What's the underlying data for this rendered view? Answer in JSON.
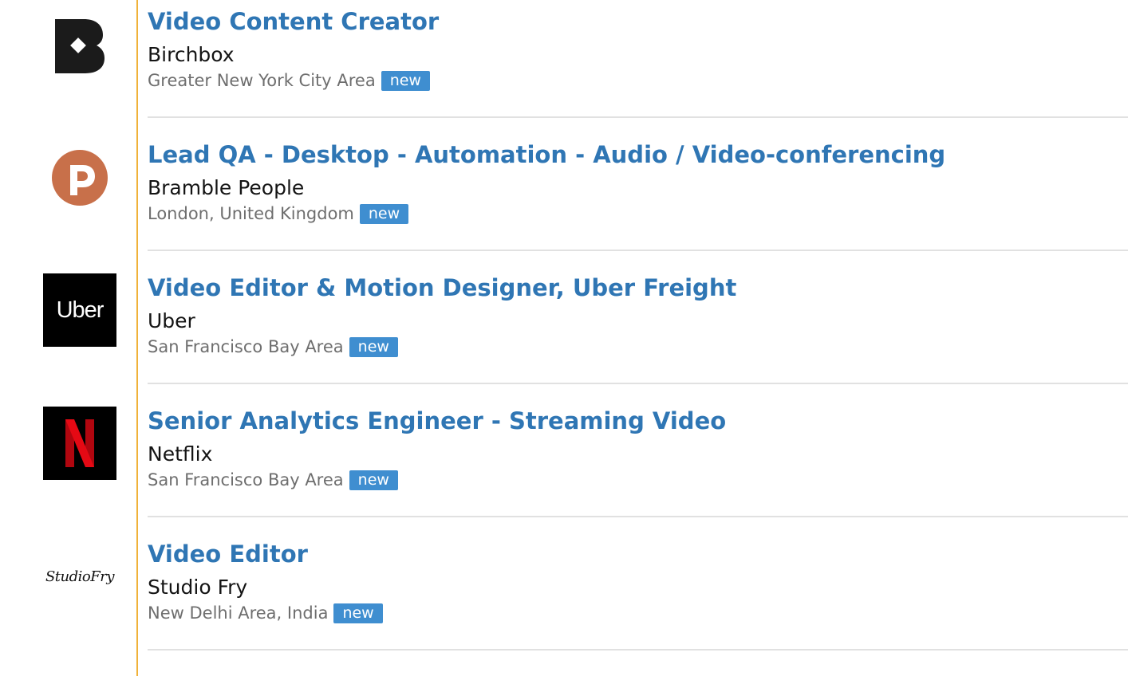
{
  "jobs": [
    {
      "title": "Video Content Creator",
      "company": "Birchbox",
      "location": "Greater New York City Area",
      "badge": "new",
      "logo_icon": "birchbox-logo",
      "logo_colors": {
        "bg": "#ffffff",
        "fg": "#1b1b1b"
      }
    },
    {
      "title": "Lead QA - Desktop - Automation - Audio / Video-conferencing",
      "company": "Bramble People",
      "location": "London, United Kingdom",
      "badge": "new",
      "logo_icon": "bramble-people-logo",
      "logo_colors": {
        "bg": "#c8704a",
        "fg": "#ffffff"
      }
    },
    {
      "title": "Video Editor & Motion Designer, Uber Freight",
      "company": "Uber",
      "location": "San Francisco Bay Area",
      "badge": "new",
      "logo_icon": "uber-logo",
      "logo_text": "Uber",
      "logo_colors": {
        "bg": "#000000",
        "fg": "#ffffff"
      }
    },
    {
      "title": "Senior Analytics Engineer - Streaming Video",
      "company": "Netflix",
      "location": "San Francisco Bay Area",
      "badge": "new",
      "logo_icon": "netflix-logo",
      "logo_colors": {
        "bg": "#000000",
        "fg": "#d81f26"
      }
    },
    {
      "title": "Video Editor",
      "company": "Studio Fry",
      "location": "New Delhi Area, India",
      "badge": "new",
      "logo_icon": "studio-fry-logo",
      "logo_text": "StudioFry",
      "logo_colors": {
        "bg": "#ffffff",
        "fg": "#111111"
      }
    }
  ],
  "colors": {
    "title": "#2f76b4",
    "badge": "#3f8ed0",
    "accent_line": "#f0b23a",
    "separator": "#e1e1e1"
  }
}
